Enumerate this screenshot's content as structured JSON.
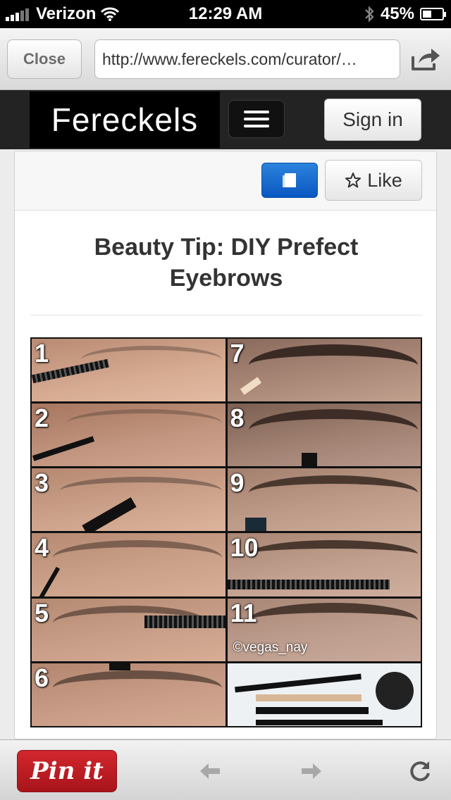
{
  "status_bar": {
    "carrier": "Verizon",
    "time": "12:29 AM",
    "battery": "45%",
    "battery_level": 0.45
  },
  "browser": {
    "close_label": "Close",
    "url": "http://www.fereckels.com/curator/…"
  },
  "site": {
    "logo": "Fereckels",
    "signin_label": "Sign in"
  },
  "card": {
    "like_label": "Like",
    "title": "Beauty Tip: DIY Prefect Eyebrows"
  },
  "image": {
    "steps": [
      "1",
      "2",
      "3",
      "4",
      "5",
      "6",
      "7",
      "8",
      "9",
      "10",
      "11"
    ],
    "credit": "©vegas_nay"
  },
  "bottom_bar": {
    "pin_label": "Pin it"
  },
  "colors": {
    "pin_red": "#c81f26",
    "action_blue": "#0a57c2"
  }
}
